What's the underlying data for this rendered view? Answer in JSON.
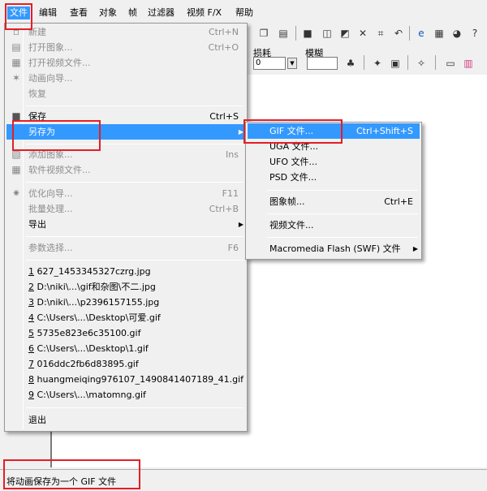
{
  "menubar": {
    "items": [
      "文件",
      "编辑",
      "查看",
      "对象",
      "帧",
      "过滤器",
      "视频 F/X",
      "帮助"
    ]
  },
  "toolbar": {
    "label_dithering": "损耗",
    "label_blur": "模糊",
    "value_dithering": "0"
  },
  "file_menu": {
    "group1": [
      {
        "label": "新建",
        "shortcut": "Ctrl+N",
        "icon": "new-doc-icon"
      },
      {
        "label": "打开图象...",
        "shortcut": "Ctrl+O",
        "icon": "open-image-icon"
      },
      {
        "label": "打开视频文件...",
        "shortcut": "",
        "icon": "open-video-icon"
      },
      {
        "label": "动画向导...",
        "shortcut": "",
        "icon": "wizard-icon"
      },
      {
        "label": "恢复",
        "shortcut": "",
        "icon": ""
      }
    ],
    "save": {
      "label": "保存",
      "shortcut": "Ctrl+S"
    },
    "save_as": {
      "label": "另存为"
    },
    "group3": [
      {
        "label": "添加图象...",
        "shortcut": "Ins",
        "icon": "add-image-icon"
      },
      {
        "label": "软件视频文件...",
        "shortcut": "",
        "icon": "video-file-icon"
      }
    ],
    "group4": [
      {
        "label": "优化向导...",
        "shortcut": "F11",
        "icon": "optimize-icon"
      },
      {
        "label": "批量处理...",
        "shortcut": "Ctrl+B",
        "icon": ""
      },
      {
        "label": "导出",
        "shortcut": "",
        "icon": ""
      }
    ],
    "preferences": {
      "label": "参数选择...",
      "shortcut": "F6"
    },
    "recent": [
      {
        "num": "1",
        "name": " 627_1453345327czrg.jpg"
      },
      {
        "num": "2",
        "name": " D:\\niki\\...\\gif和杂图\\不二.jpg"
      },
      {
        "num": "3",
        "name": " D:\\niki\\...\\p2396157155.jpg"
      },
      {
        "num": "4",
        "name": " C:\\Users\\...\\Desktop\\可爱.gif"
      },
      {
        "num": "5",
        "name": " 5735e823e6c35100.gif"
      },
      {
        "num": "6",
        "name": " C:\\Users\\...\\Desktop\\1.gif"
      },
      {
        "num": "7",
        "name": " 016ddc2fb6d83895.gif"
      },
      {
        "num": "8",
        "name": " huangmeiqing976107_1490841407189_41.gif"
      },
      {
        "num": "9",
        "name": " C:\\Users\\...\\matomng.gif"
      }
    ],
    "exit": {
      "label": "退出"
    }
  },
  "save_as_submenu": {
    "items": [
      {
        "label": "GIF 文件...",
        "shortcut": "Ctrl+Shift+S"
      },
      {
        "label": "UGA 文件...",
        "shortcut": ""
      },
      {
        "label": "UFO 文件...",
        "shortcut": ""
      },
      {
        "label": "PSD 文件...",
        "shortcut": ""
      },
      {
        "label": "图象帧...",
        "shortcut": "Ctrl+E"
      },
      {
        "label": "视频文件...",
        "shortcut": ""
      },
      {
        "label": "Macromedia Flash (SWF) 文件",
        "shortcut": ""
      }
    ]
  },
  "status": {
    "text": "将动画保存为一个 GIF 文件"
  },
  "colors": {
    "highlight": "#3399ff",
    "annotation": "#e41e26"
  }
}
